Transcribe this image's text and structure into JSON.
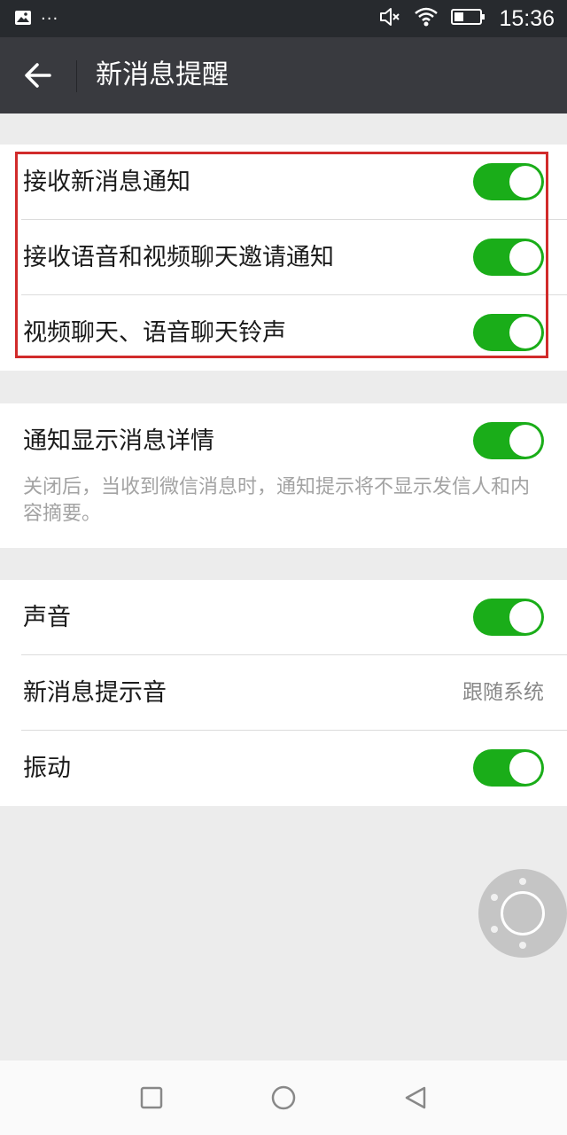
{
  "status_bar": {
    "time": "15:36",
    "left_icons": [
      "image-icon",
      "more-dots-icon"
    ],
    "right_icons": [
      "mute-icon",
      "wifi-icon",
      "battery-icon"
    ],
    "dots": "···"
  },
  "header": {
    "title": "新消息提醒",
    "back_icon": "back-arrow-icon"
  },
  "groups": [
    {
      "items": [
        {
          "label": "接收新消息通知",
          "toggle": true
        },
        {
          "label": "接收语音和视频聊天邀请通知",
          "toggle": true
        },
        {
          "label": "视频聊天、语音聊天铃声",
          "toggle": true
        }
      ]
    },
    {
      "items": [
        {
          "label": "通知显示消息详情",
          "toggle": true,
          "description": "关闭后，当收到微信消息时，通知提示将不显示发信人和内容摘要。"
        }
      ]
    },
    {
      "items": [
        {
          "label": "声音",
          "toggle": true
        },
        {
          "label": "新消息提示音",
          "value": "跟随系统"
        },
        {
          "label": "振动",
          "toggle": true
        }
      ]
    }
  ],
  "nav_bar": {
    "buttons": [
      "recent-apps-icon",
      "home-icon",
      "back-triangle-icon"
    ]
  },
  "colors": {
    "accent": "#1aad19",
    "highlight": "#d12b2b",
    "app_bar": "#393a3f",
    "status_bar": "#272a2e"
  }
}
